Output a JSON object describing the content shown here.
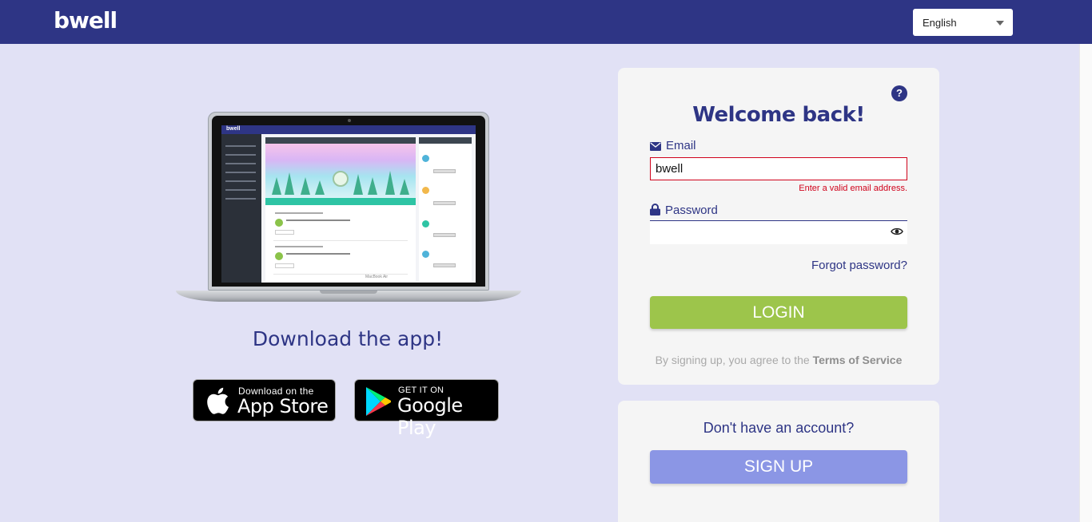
{
  "header": {
    "logo_text": "bwell",
    "language": "English"
  },
  "promo": {
    "laptop_brand": "MacBook Air",
    "screen_app_name": "bwell",
    "download_title": "Download the app!",
    "app_store": {
      "small": "Download on the",
      "big": "App Store"
    },
    "google_play": {
      "small": "GET IT ON",
      "big": "Google Play"
    }
  },
  "login": {
    "help_icon_text": "?",
    "title": "Welcome back!",
    "email_label": "Email",
    "email_value": "bwell",
    "email_error": "Enter a valid email address.",
    "password_label": "Password",
    "password_value": "",
    "forgot_password": "Forgot password?",
    "login_button": "LOGIN",
    "terms_prefix": "By signing up, you agree to the ",
    "terms_link": "Terms of Service"
  },
  "signup": {
    "prompt": "Don't have an account?",
    "button": "SIGN UP"
  },
  "colors": {
    "brand": "#2e3585",
    "background": "#e1e1f5",
    "login_button": "#9dc54b",
    "signup_button": "#8b96e5",
    "error": "#d0021b"
  },
  "icons": [
    "envelope-icon",
    "lock-icon",
    "eye-icon",
    "help-icon",
    "apple-icon",
    "google-play-icon",
    "chevron-down-icon"
  ]
}
